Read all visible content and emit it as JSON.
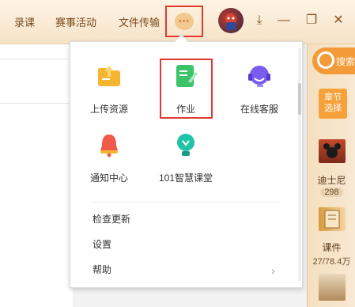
{
  "topbar": {
    "nav": [
      "录课",
      "赛事活动",
      "文件传输"
    ],
    "more_label": "···",
    "download_glyph": "⤓",
    "minimize_glyph": "—",
    "restore_glyph": "❐",
    "close_glyph": "✕"
  },
  "sidebar_right": {
    "search_label": "搜索",
    "chapter_label_1": "章节",
    "chapter_label_2": "选择",
    "resources": [
      {
        "label": "迪士尼",
        "count": "298"
      },
      {
        "label": "课件",
        "count": "27/78.4万"
      }
    ]
  },
  "dropdown": {
    "tiles": [
      {
        "label": "上传资源",
        "icon": "upload-folder-icon"
      },
      {
        "label": "作业",
        "icon": "homework-icon"
      },
      {
        "label": "在线客服",
        "icon": "headset-icon"
      },
      {
        "label": "通知中心",
        "icon": "bell-icon"
      },
      {
        "label": "101智慧课堂",
        "icon": "lamp-icon"
      }
    ],
    "menu": [
      "检查更新",
      "设置",
      "帮助"
    ]
  },
  "colors": {
    "accent_orange": "#f29b38",
    "highlight_red": "#e03a2f",
    "homework_green": "#3cc46a",
    "headset_purple": "#7b5cf0",
    "bell_red": "#f05a4a",
    "lamp_teal": "#22c2a8"
  }
}
